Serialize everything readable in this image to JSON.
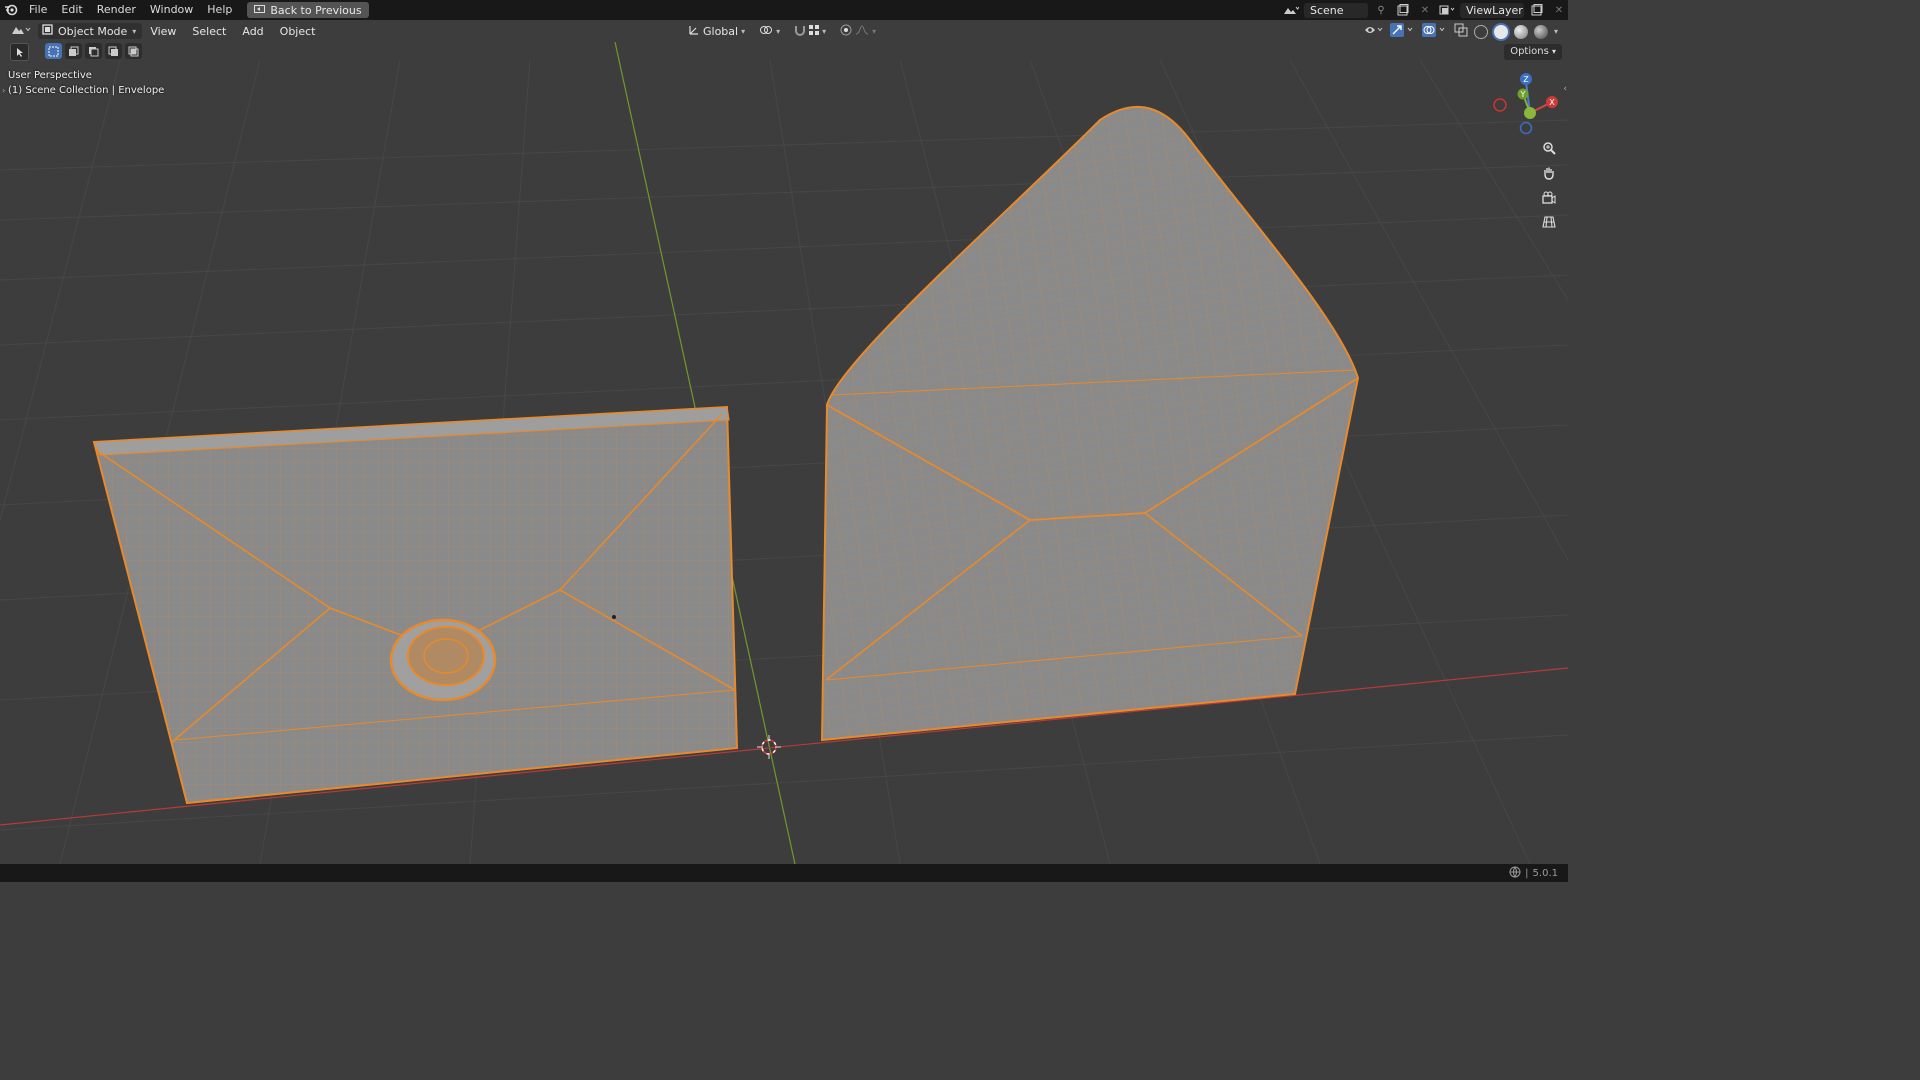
{
  "topbar": {
    "menus": [
      "File",
      "Edit",
      "Render",
      "Window",
      "Help"
    ],
    "back_button": "Back to Previous",
    "scene_name": "Scene",
    "view_layer": "ViewLayer"
  },
  "viewport_header": {
    "mode": "Object Mode",
    "menus": [
      "View",
      "Select",
      "Add",
      "Object"
    ],
    "transform_orientation": "Global",
    "options_label": "Options"
  },
  "overlay": {
    "perspective": "User Perspective",
    "collection_info": "(1) Scene Collection | Envelope"
  },
  "gizmo": {
    "z_label": "Z",
    "y_label": "Y",
    "x_label": "X"
  },
  "status": {
    "version": "5.0.1"
  },
  "colors": {
    "selection_orange": "#e8892b",
    "mesh_gray": "#8a8a8a",
    "x_axis_red": "#b53a3a",
    "y_axis_green": "#6f9a2a",
    "viewport_bg": "#3d3d3d"
  }
}
